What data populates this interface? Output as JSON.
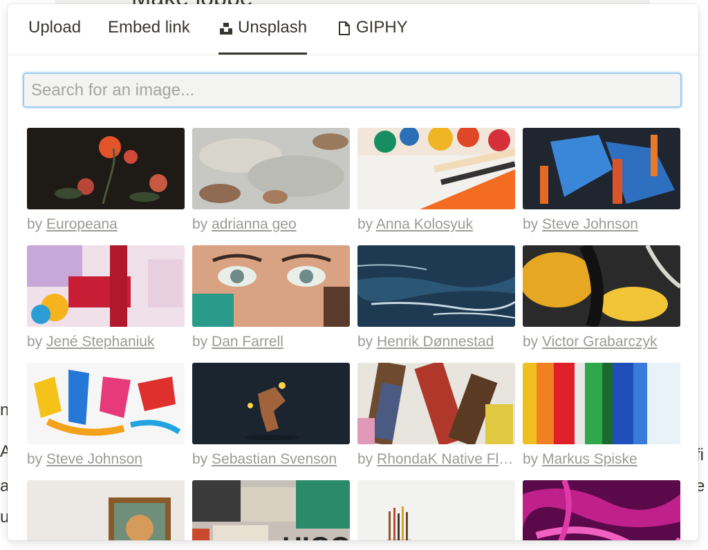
{
  "background": {
    "heading_fragment": "Make lobbe",
    "left_fragments": [
      "n",
      "A",
      "a",
      "u"
    ],
    "right_fragments": [
      "fi",
      "e"
    ]
  },
  "tabs": [
    {
      "label": "Upload",
      "icon": null,
      "active": false
    },
    {
      "label": "Embed link",
      "icon": null,
      "active": false
    },
    {
      "label": "Unsplash",
      "icon": "unsplash-icon",
      "active": true
    },
    {
      "label": "GIPHY",
      "icon": "giphy-icon",
      "active": false
    }
  ],
  "search": {
    "placeholder": "Search for an image...",
    "value": ""
  },
  "credit_prefix": "by",
  "images": [
    {
      "author": "Europeana",
      "subject": "dark floral still life painting"
    },
    {
      "author": "adrianna geo",
      "subject": "faded fresco sky"
    },
    {
      "author": "Anna Kolosyuk",
      "subject": "paint tubes and brushes"
    },
    {
      "author": "Steve Johnson",
      "subject": "blue and orange abstract paint"
    },
    {
      "author": "Jené Stephaniuk",
      "subject": "colorful abstract canvas"
    },
    {
      "author": "Dan Farrell",
      "subject": "graffiti face mural"
    },
    {
      "author": "Henrik Dønnestad",
      "subject": "stormy sea painting"
    },
    {
      "author": "Victor Grabarczyk",
      "subject": "yellow and black fluid art"
    },
    {
      "author": "Steve Johnson",
      "subject": "bright paint splashes"
    },
    {
      "author": "Sebastian Svenson",
      "subject": "dark 3d figure with lights"
    },
    {
      "author": "RhondaK Native Florida Folk Artist",
      "subject": "used paint brushes"
    },
    {
      "author": "Markus Spiske",
      "subject": "rainbow paint stripes"
    },
    {
      "author": "",
      "subject": "framed portrait on wall"
    },
    {
      "author": "",
      "subject": "torn posters wall"
    },
    {
      "author": "",
      "subject": "brushes in jar"
    },
    {
      "author": "",
      "subject": "magenta fluid paint"
    }
  ]
}
